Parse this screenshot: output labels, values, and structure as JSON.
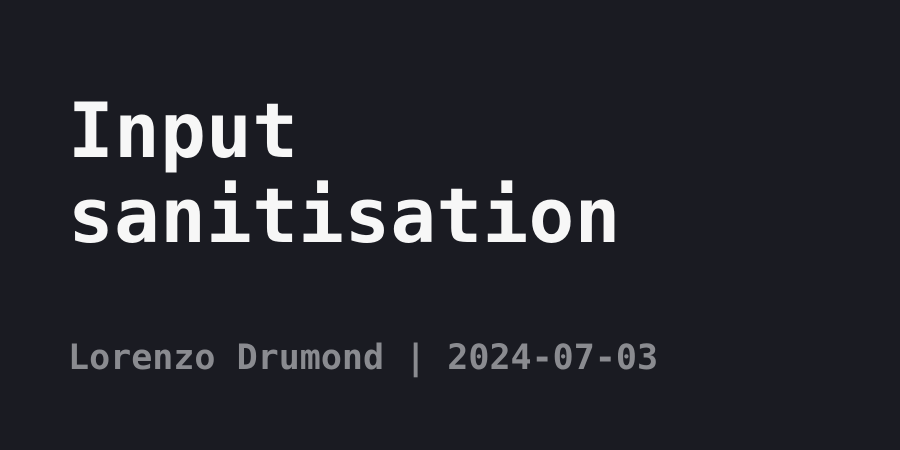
{
  "title": {
    "line1": "Input",
    "line2": "sanitisation"
  },
  "byline": {
    "author": "Lorenzo Drumond",
    "separator": " | ",
    "date": "2024-07-03"
  },
  "colors": {
    "background": "#1a1b22",
    "title": "#f7f7f7",
    "byline": "#8a8b90"
  }
}
